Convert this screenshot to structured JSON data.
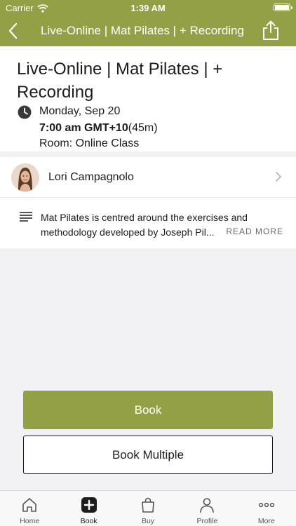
{
  "status_bar": {
    "carrier": "Carrier",
    "time": "1:39 AM"
  },
  "nav": {
    "title": "Live-Online | Mat Pilates | + Recording"
  },
  "class": {
    "title": "Live-Online | Mat Pilates | + Recording",
    "date": "Monday, Sep 20",
    "time_bold": "7:00 am GMT+10",
    "duration": "(45m)",
    "room": "Room: Online Class"
  },
  "instructor": {
    "name": "Lori Campagnolo"
  },
  "description": {
    "text": "Mat Pilates is centred around the exercises and methodology developed by Joseph Pil...",
    "read_more": "READ MORE"
  },
  "buttons": {
    "book": "Book",
    "book_multiple": "Book Multiple"
  },
  "tabs": [
    {
      "label": "Home",
      "icon": "home-icon"
    },
    {
      "label": "Book",
      "icon": "plus-square-icon"
    },
    {
      "label": "Buy",
      "icon": "bag-icon"
    },
    {
      "label": "Profile",
      "icon": "person-icon"
    },
    {
      "label": "More",
      "icon": "more-icon"
    }
  ],
  "colors": {
    "brand": "#93a046",
    "text": "#1c1c1e",
    "background": "#f2f2f4"
  }
}
